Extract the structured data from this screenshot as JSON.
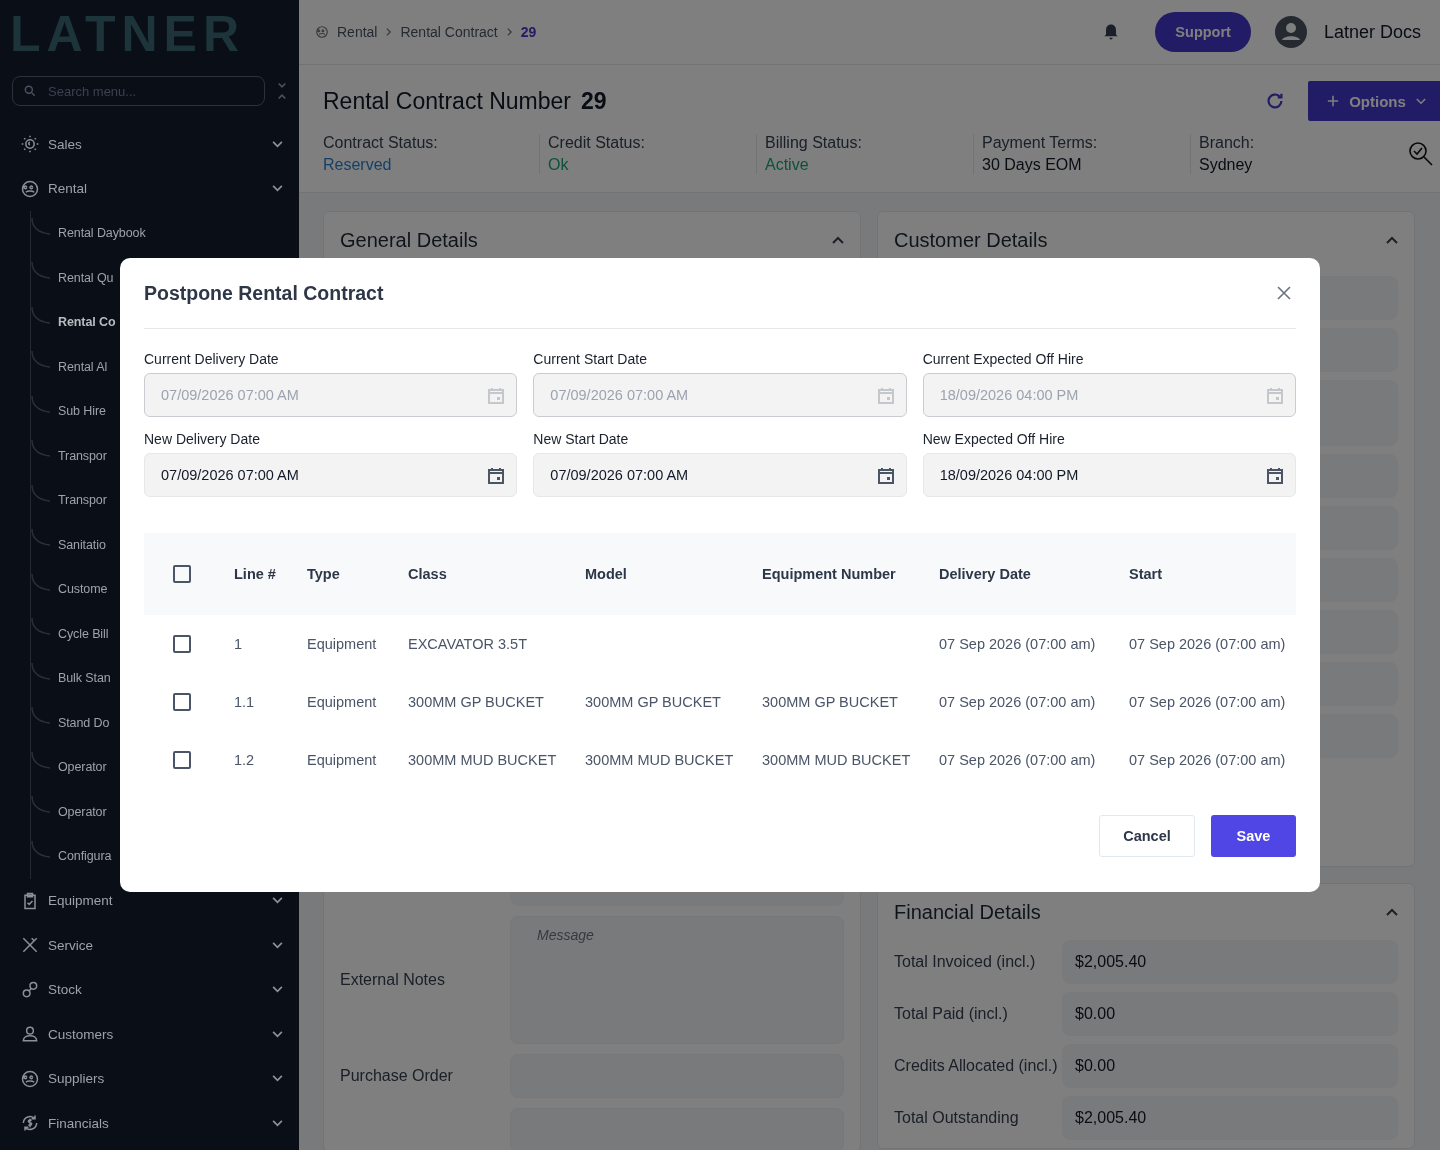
{
  "sidebar": {
    "logo": "LATNER",
    "search": {
      "placeholder": "Search menu..."
    },
    "items": [
      {
        "label": "Sales"
      },
      {
        "label": "Rental",
        "children": [
          {
            "label": "Rental Daybook",
            "selected": false
          },
          {
            "label": "Rental Qu",
            "selected": false
          },
          {
            "label": "Rental Co",
            "selected": true
          },
          {
            "label": "Rental Al",
            "selected": false
          },
          {
            "label": "Sub Hire",
            "selected": false
          },
          {
            "label": "Transpor",
            "selected": false
          },
          {
            "label": "Transpor",
            "selected": false
          },
          {
            "label": "Sanitatio",
            "selected": false
          },
          {
            "label": "Custome",
            "selected": false
          },
          {
            "label": "Cycle Bill",
            "selected": false
          },
          {
            "label": "Bulk Stan",
            "selected": false
          },
          {
            "label": "Stand Do",
            "selected": false
          },
          {
            "label": "Operator",
            "selected": false
          },
          {
            "label": "Operator",
            "selected": false
          },
          {
            "label": "Configura",
            "selected": false
          }
        ]
      },
      {
        "label": "Equipment"
      },
      {
        "label": "Service"
      },
      {
        "label": "Stock"
      },
      {
        "label": "Customers"
      },
      {
        "label": "Suppliers"
      },
      {
        "label": "Financials"
      }
    ]
  },
  "header": {
    "breadcrumbs": [
      {
        "label": "Rental",
        "selected": false
      },
      {
        "label": "Rental Contract",
        "selected": false
      },
      {
        "label": "29",
        "selected": true
      }
    ],
    "support_button": "Support",
    "user": "Latner Docs"
  },
  "contract": {
    "title": "Rental Contract Number",
    "number": "29",
    "options_button": "Options",
    "statuses": [
      {
        "label": "Contract Status:",
        "value": "Reserved",
        "kind": "info"
      },
      {
        "label": "Credit Status:",
        "value": "Ok",
        "kind": "success"
      },
      {
        "label": "Billing Status:",
        "value": "Active",
        "kind": "success"
      },
      {
        "label": "Payment Terms:",
        "value": "30 Days EOM",
        "kind": "plain"
      },
      {
        "label": "Branch:",
        "value": "Sydney",
        "kind": "plain"
      }
    ]
  },
  "general_details": {
    "title": "General Details",
    "fields": [
      {
        "label": "External Notes",
        "placeholder": "Message",
        "kind": "textarea"
      },
      {
        "label": "Purchase Order",
        "kind": "input"
      }
    ]
  },
  "customer_details": {
    "title": "Customer Details"
  },
  "financial_details": {
    "title": "Financial Details",
    "rows": [
      {
        "label": "Total Invoiced (incl.)",
        "value": "$2,005.40"
      },
      {
        "label": "Total Paid (incl.)",
        "value": "$0.00"
      },
      {
        "label": "Credits Allocated (incl.)",
        "value": "$0.00"
      },
      {
        "label": "Total Outstanding",
        "value": "$2,005.40"
      }
    ]
  },
  "modal": {
    "title": "Postpone Rental Contract",
    "fields": [
      {
        "label": "Current Delivery Date",
        "value": "07/09/2026 07:00 AM",
        "disabled": true
      },
      {
        "label": "Current Start Date",
        "value": "07/09/2026 07:00 AM",
        "disabled": true
      },
      {
        "label": "Current Expected Off Hire",
        "value": "18/09/2026 04:00 PM",
        "disabled": true
      },
      {
        "label": "New Delivery Date",
        "value": "07/09/2026 07:00 AM",
        "disabled": false
      },
      {
        "label": "New Start Date",
        "value": "07/09/2026 07:00 AM",
        "disabled": false
      },
      {
        "label": "New Expected Off Hire",
        "value": "18/09/2026 04:00 PM",
        "disabled": false
      }
    ],
    "table": {
      "all_checked": false,
      "columns": [
        "Line #",
        "Type",
        "Class",
        "Model",
        "Equipment Number",
        "Delivery Date",
        "Start"
      ],
      "rows": [
        {
          "checked": false,
          "cells": [
            "1",
            "Equipment",
            "EXCAVATOR 3.5T",
            "",
            "",
            "07 Sep 2026 (07:00 am)",
            "07 Sep 2026 (07:00 am)"
          ]
        },
        {
          "checked": false,
          "cells": [
            "1.1",
            "Equipment",
            "300MM GP BUCKET",
            "300MM GP BUCKET",
            "300MM GP BUCKET",
            "07 Sep 2026 (07:00 am)",
            "07 Sep 2026 (07:00 am)"
          ]
        },
        {
          "checked": false,
          "cells": [
            "1.2",
            "Equipment",
            "300MM MUD BUCKET",
            "300MM MUD BUCKET",
            "300MM MUD BUCKET",
            "07 Sep 2026 (07:00 am)",
            "07 Sep 2026 (07:00 am)"
          ]
        }
      ]
    },
    "cancel_button": "Cancel",
    "save_button": "Save"
  }
}
